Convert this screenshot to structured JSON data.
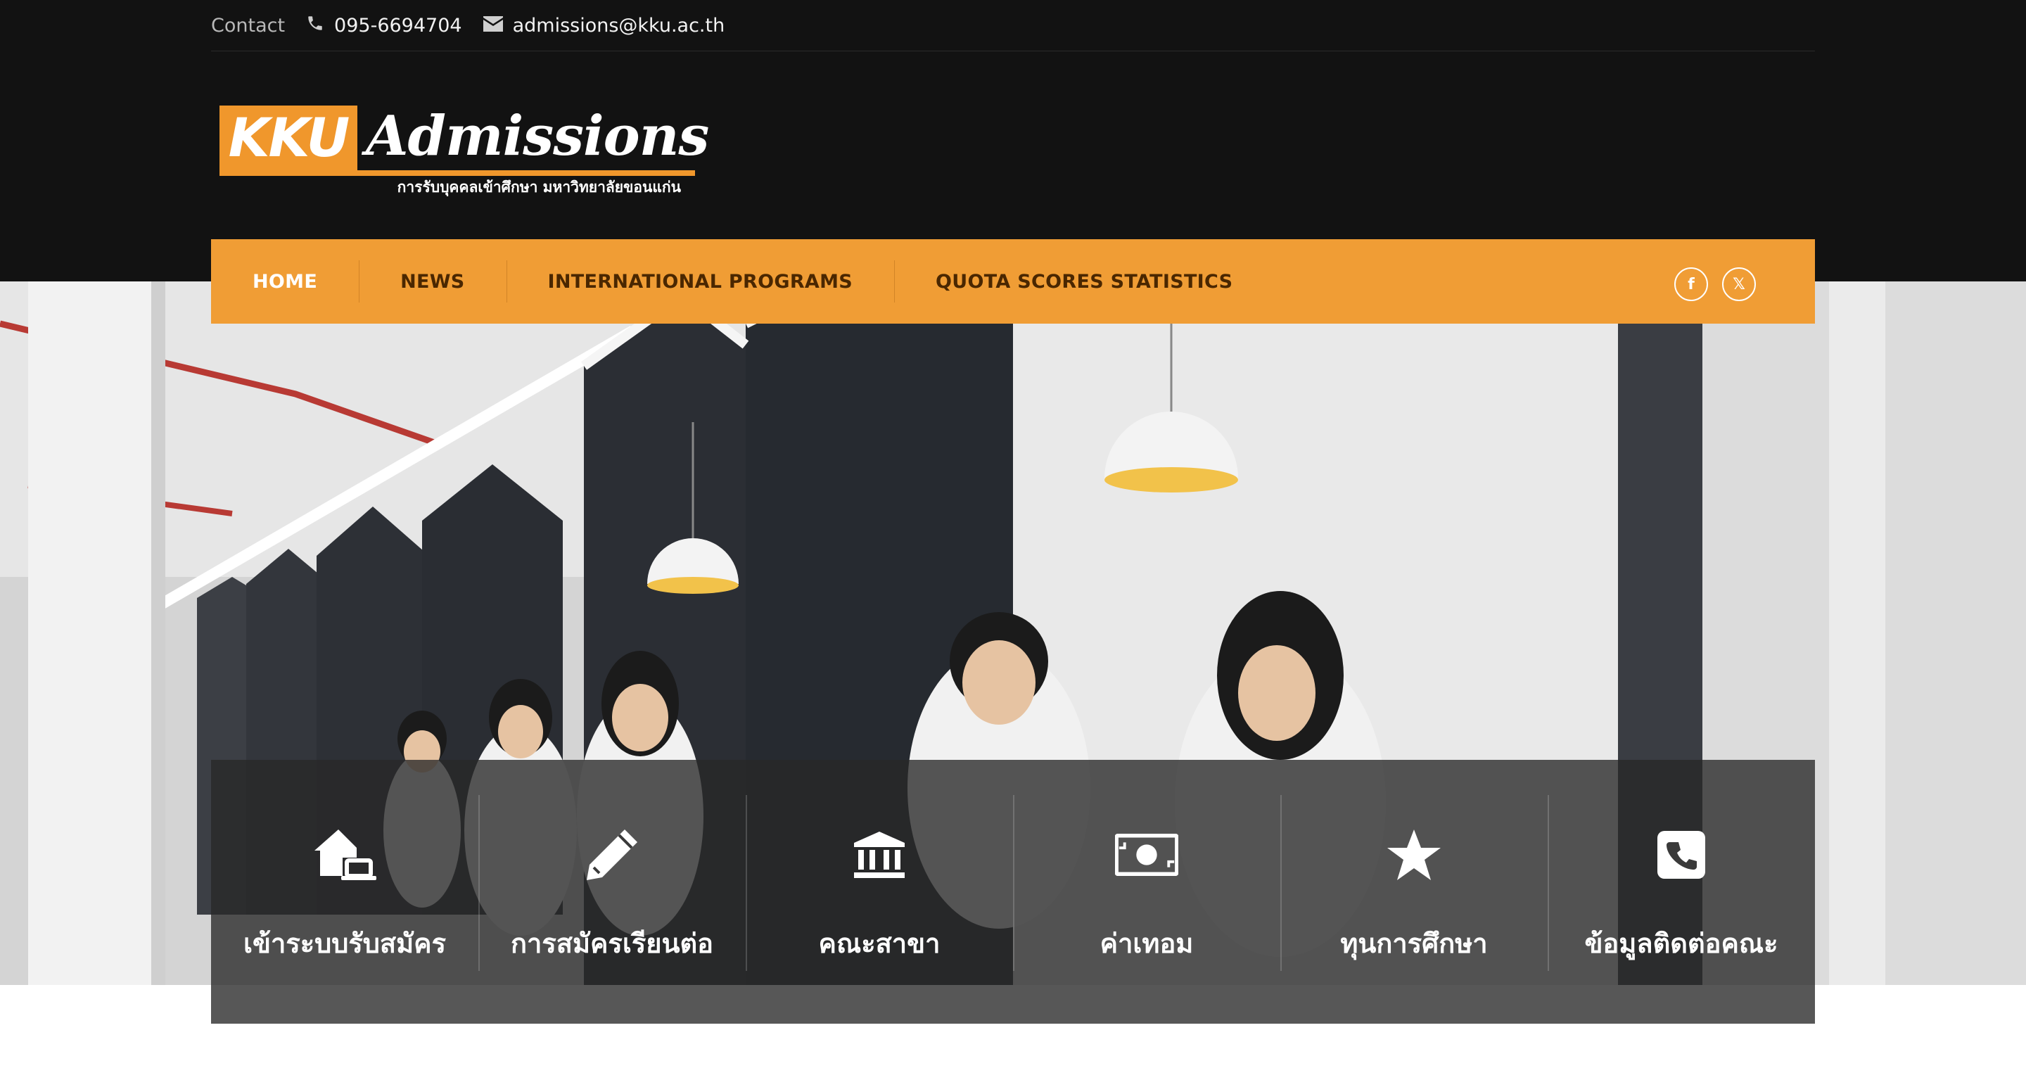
{
  "contact": {
    "label": "Contact",
    "phone": "095-6694704",
    "email": "admissions@kku.ac.th"
  },
  "logo": {
    "brand": "KKU",
    "title": "Admissions",
    "subtitle": "การรับบุคคลเข้าศึกษา มหาวิทยาลัยขอนแก่น"
  },
  "nav": {
    "items": [
      {
        "label": "HOME",
        "active": true
      },
      {
        "label": "NEWS",
        "active": false
      },
      {
        "label": "INTERNATIONAL PROGRAMS",
        "active": false
      },
      {
        "label": "QUOTA SCORES STATISTICS",
        "active": false
      }
    ],
    "social": {
      "facebook": "f",
      "x": "𝕏"
    }
  },
  "quick_links": [
    {
      "label": "เข้าระบบรับสมัคร",
      "icon": "house-laptop-icon"
    },
    {
      "label": "การสมัครเรียนต่อ",
      "icon": "pencil-icon"
    },
    {
      "label": "คณะสาขา",
      "icon": "building-columns-icon"
    },
    {
      "label": "ค่าเทอม",
      "icon": "money-bill-icon"
    },
    {
      "label": "ทุนการศึกษา",
      "icon": "star-icon"
    },
    {
      "label": "ข้อมูลติดต่อคณะ",
      "icon": "phone-square-icon"
    }
  ],
  "colors": {
    "accent": "#f09d35",
    "header_bg": "#121212"
  }
}
